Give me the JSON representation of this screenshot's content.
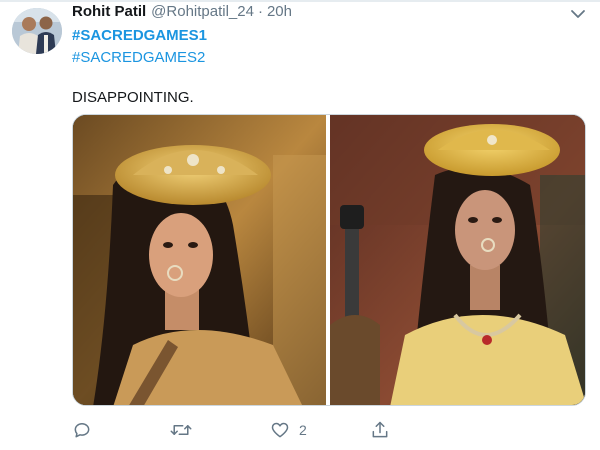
{
  "tweet": {
    "display_name": "Rohit Patil",
    "handle": "@Rohitpatil_24",
    "separator": "·",
    "timestamp": "20h",
    "hashtag_1": "#SACREDGAMES1",
    "hashtag_2": "#SACREDGAMES2",
    "text": "DISAPPOINTING."
  },
  "actions": {
    "reply_count": "",
    "retweet_count": "",
    "like_count": "2"
  },
  "colors": {
    "link": "#1b95e0",
    "secondary_text": "#657786",
    "primary_text": "#14171a",
    "border": "#ccd6dd"
  },
  "icons": [
    "chevron-down-icon",
    "reply-icon",
    "retweet-icon",
    "like-icon",
    "share-icon"
  ]
}
